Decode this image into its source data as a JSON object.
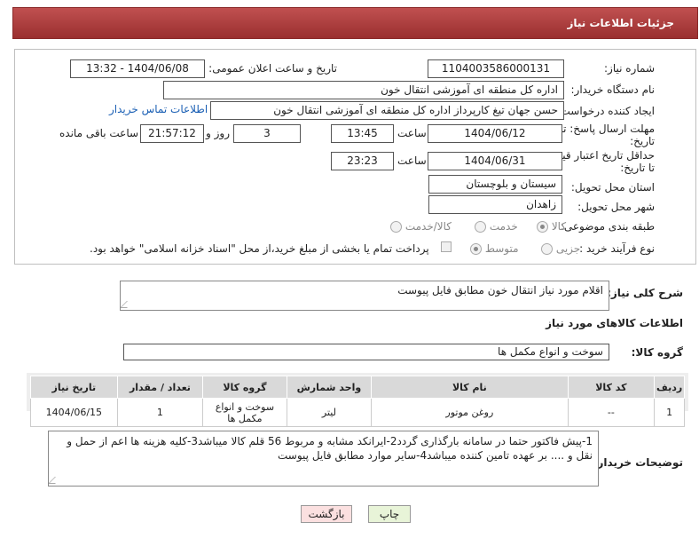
{
  "header": {
    "title": "جزئیات اطلاعات نیاز"
  },
  "form": {
    "need_number": {
      "label": "شماره نیاز:",
      "value": "1104003586000131"
    },
    "announce_datetime": {
      "label": "تاریخ و ساعت اعلان عمومی:",
      "value": "1404/06/08 - 13:32"
    },
    "buyer_org": {
      "label": "نام دستگاه خریدار:",
      "value": "اداره کل منطقه ای آموزشی انتقال خون"
    },
    "requester": {
      "label": "ایجاد کننده درخواست:",
      "value": "حسن جهان تیغ کارپرداز اداره کل منطقه ای آموزشی انتقال خون",
      "contact_link": "اطلاعات تماس خریدار"
    },
    "reply_deadline": {
      "label_line1": "مهلت ارسال پاسخ: تا",
      "label_line2": "تاریخ:",
      "date": "1404/06/12",
      "time_label": "ساعت",
      "time": "13:45",
      "days": "3",
      "days_label": "روز و",
      "remaining": "21:57:12",
      "remaining_label": "ساعت باقی مانده"
    },
    "price_validity": {
      "label_line1": "حداقل تاریخ اعتبار قیمت:",
      "label_line2": "تا تاریخ:",
      "date": "1404/06/31",
      "time_label": "ساعت",
      "time": "23:23"
    },
    "province": {
      "label": "استان محل تحویل:",
      "value": "سیستان و بلوچستان"
    },
    "city": {
      "label": "شهر محل تحویل:",
      "value": "زاهدان"
    },
    "category": {
      "label": "طبقه بندی موضوعی:",
      "options": [
        "کالا",
        "خدمت",
        "کالا/خدمت"
      ],
      "selected": "کالا"
    },
    "process": {
      "label": "نوع فرآیند خرید :",
      "options": [
        "جزیی",
        "متوسط"
      ],
      "selected": "متوسط",
      "note": "پرداخت تمام یا بخشی از مبلغ خرید،از محل \"اسناد خزانه اسلامی\" خواهد بود."
    }
  },
  "summary": {
    "label": "شرح کلی نیاز:",
    "value": "اقلام مورد نیاز انتقال خون مطابق فایل پیوست"
  },
  "goods_section": {
    "title": "اطلاعات کالاهای مورد نیاز"
  },
  "goods_group": {
    "label": "گروه کالا:",
    "value": "سوخت و انواع مکمل ها"
  },
  "table": {
    "headers": [
      "ردیف",
      "کد کالا",
      "نام کالا",
      "واحد شمارش",
      "گروه کالا",
      "تعداد / مقدار",
      "تاریخ نیاز"
    ],
    "rows": [
      [
        "1",
        "--",
        "روغن موتور",
        "لیتر",
        "سوخت و انواع مکمل ها",
        "1",
        "1404/06/15"
      ]
    ]
  },
  "buyer_notes": {
    "label": "توضیحات خریدار:",
    "value": "1-پیش فاکتور حتما در سامانه بارگذاری گردد2-ایرانکد مشابه و مربوط 56 قلم کالا میباشد3-کلیه هزینه ها اعم از حمل و نقل و .... بر عهده تامین کننده میباشد4-سایر موارد مطابق فایل پیوست"
  },
  "buttons": {
    "print": "چاپ",
    "back": "بازگشت"
  }
}
